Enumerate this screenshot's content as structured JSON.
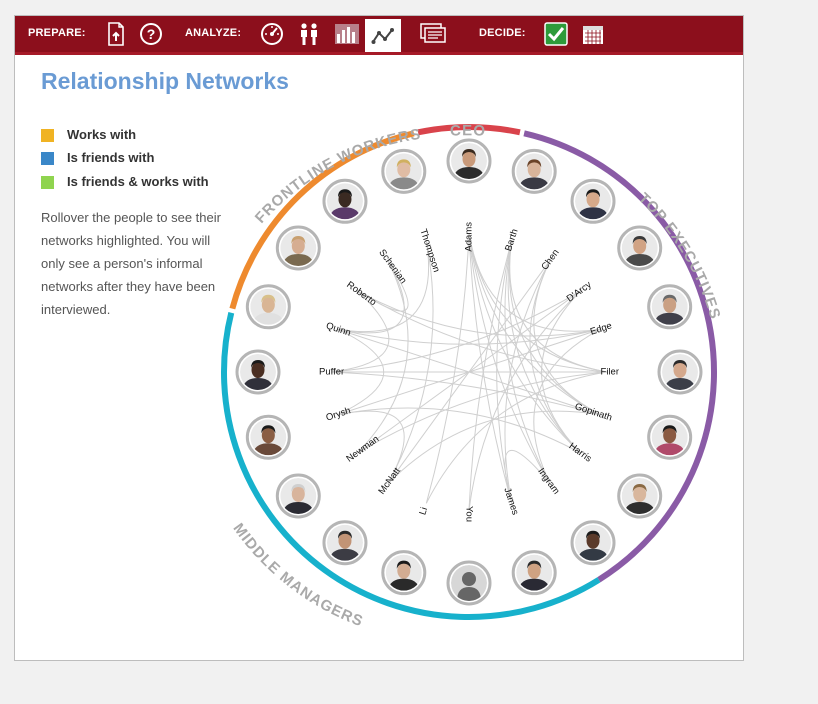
{
  "toolbar": {
    "prepare_label": "PREPARE:",
    "analyze_label": "ANALYZE:",
    "decide_label": "DECIDE:",
    "icons": [
      "document-upload-icon",
      "help-icon",
      "gauge-icon",
      "people-icon",
      "bar-chart-icon",
      "network-icon",
      "slides-icon",
      "checkbox-icon",
      "calendar-icon"
    ]
  },
  "page_title": "Relationship Networks",
  "legend": [
    {
      "label": "Works with",
      "color": "#f0b323"
    },
    {
      "label": "Is friends with",
      "color": "#3a87c8"
    },
    {
      "label": "Is friends & works with",
      "color": "#8fd44f"
    }
  ],
  "instructions": "Rollover the people to see their networks highlighted. You will only see a person's informal networks after they have been interviewed.",
  "groups": [
    {
      "name": "CEO",
      "color": "#d9434b"
    },
    {
      "name": "TOP EXECUTIVES",
      "color": "#8a5ba6"
    },
    {
      "name": "MIDDLE MANAGERS",
      "color": "#17b1cc"
    },
    {
      "name": "FRONTLINE WORKERS",
      "color": "#ee8a2e"
    }
  ],
  "people": [
    "Adams",
    "Barth",
    "Chen",
    "D'Arcy",
    "Edge",
    "Filer",
    "Gopinath",
    "Harris",
    "Ingram",
    "James",
    "You",
    "Li",
    "McNatt",
    "Newman",
    "Orysh",
    "Puffer",
    "Quinn",
    "Roberto",
    "Schenian",
    "Thompson"
  ]
}
